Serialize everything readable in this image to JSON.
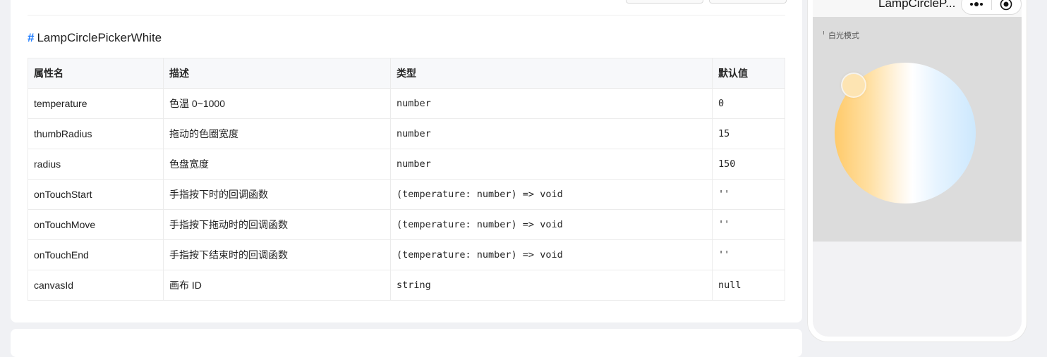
{
  "section": {
    "hash": "#",
    "title": "LampCirclePickerWhite"
  },
  "table": {
    "headers": [
      "属性名",
      "描述",
      "类型",
      "默认值"
    ],
    "rows": [
      {
        "name": "temperature",
        "desc": "色温 0~1000",
        "type": "number",
        "default": "0"
      },
      {
        "name": "thumbRadius",
        "desc": "拖动的色圈宽度",
        "type": "number",
        "default": "15"
      },
      {
        "name": "radius",
        "desc": "色盘宽度",
        "type": "number",
        "default": "150"
      },
      {
        "name": "onTouchStart",
        "desc": "手指按下时的回调函数",
        "type": "(temperature: number) => void",
        "default": "''"
      },
      {
        "name": "onTouchMove",
        "desc": "手指按下拖动时的回调函数",
        "type": "(temperature: number) => void",
        "default": "''"
      },
      {
        "name": "onTouchEnd",
        "desc": "手指按下结束时的回调函数",
        "type": "(temperature: number) => void",
        "default": "''"
      },
      {
        "name": "canvasId",
        "desc": "画布 ID",
        "type": "string",
        "default": "null"
      }
    ]
  },
  "preview": {
    "nav_title": "LampCircleP...",
    "demo_label": "白光模式",
    "icons": {
      "more": "more-dots-icon",
      "close": "record-close-icon"
    },
    "colors": {
      "warm": "#ffca6a",
      "cool": "#cde8fd",
      "accent": "#1677ff"
    }
  }
}
